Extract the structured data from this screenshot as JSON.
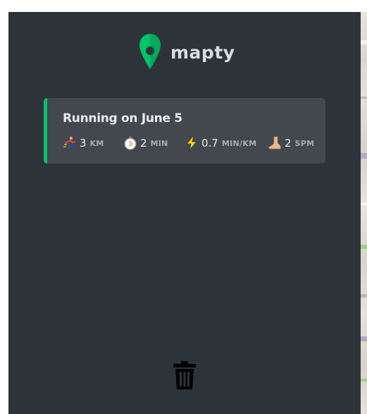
{
  "app": {
    "logo_text": "mapty",
    "brand_color": "#00c46a"
  },
  "workouts": [
    {
      "type": "running",
      "title": "Running on June 5",
      "details": [
        {
          "icon": "running-person-icon",
          "value": "3",
          "unit": "km"
        },
        {
          "icon": "stopwatch-icon",
          "value": "2",
          "unit": "min"
        },
        {
          "icon": "lightning-icon",
          "value": "0.7",
          "unit": "min/km"
        },
        {
          "icon": "foot-icon",
          "value": "2",
          "unit": "spm"
        }
      ]
    }
  ],
  "actions": {
    "delete_icon": "trash-icon"
  },
  "colors": {
    "sidebar_bg": "#2d3439",
    "card_bg": "#42484d",
    "running_accent": "#00c46a"
  }
}
